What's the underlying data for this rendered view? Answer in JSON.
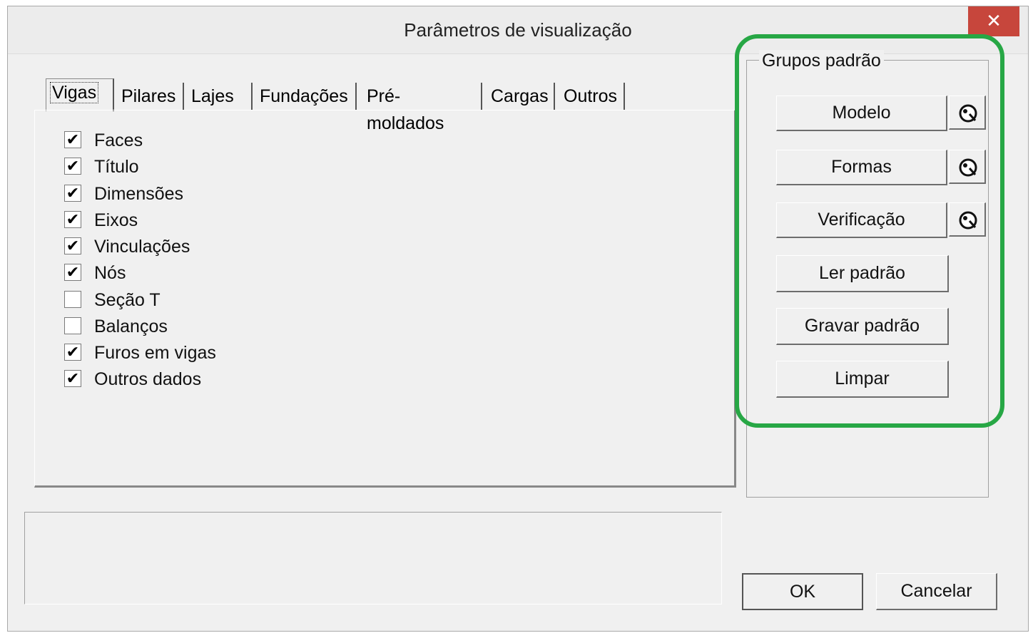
{
  "window": {
    "title": "Parâmetros de visualização",
    "close_glyph": "✕"
  },
  "tabs": [
    {
      "label": "Vigas",
      "active": true
    },
    {
      "label": "Pilares",
      "active": false
    },
    {
      "label": "Lajes",
      "active": false
    },
    {
      "label": "Fundações",
      "active": false
    },
    {
      "label": "Pré-moldados",
      "active": false
    },
    {
      "label": "Cargas",
      "active": false
    },
    {
      "label": "Outros",
      "active": false
    }
  ],
  "checkboxes": [
    {
      "label": "Faces",
      "checked": true
    },
    {
      "label": "Título",
      "checked": true
    },
    {
      "label": "Dimensões",
      "checked": true
    },
    {
      "label": "Eixos",
      "checked": true
    },
    {
      "label": "Vinculações",
      "checked": true
    },
    {
      "label": "Nós",
      "checked": true
    },
    {
      "label": "Seção T",
      "checked": false
    },
    {
      "label": "Balanços",
      "checked": false
    },
    {
      "label": "Furos em vigas",
      "checked": true
    },
    {
      "label": "Outros dados",
      "checked": true
    }
  ],
  "group": {
    "title": "Grupos padrão",
    "buttons": [
      {
        "label": "Modelo",
        "has_icon": true,
        "icon": "palette-icon"
      },
      {
        "label": "Formas",
        "has_icon": true,
        "icon": "palette-icon"
      },
      {
        "label": "Verificação",
        "has_icon": true,
        "icon": "palette-icon"
      },
      {
        "label": "Ler padrão",
        "has_icon": false
      },
      {
        "label": "Gravar padrão",
        "has_icon": false
      },
      {
        "label": "Limpar",
        "has_icon": false
      }
    ]
  },
  "footer": {
    "ok_label": "OK",
    "cancel_label": "Cancelar"
  },
  "colors": {
    "highlight": "#27a745",
    "close": "#c7463c",
    "dialog_bg": "#f0f0f0"
  }
}
